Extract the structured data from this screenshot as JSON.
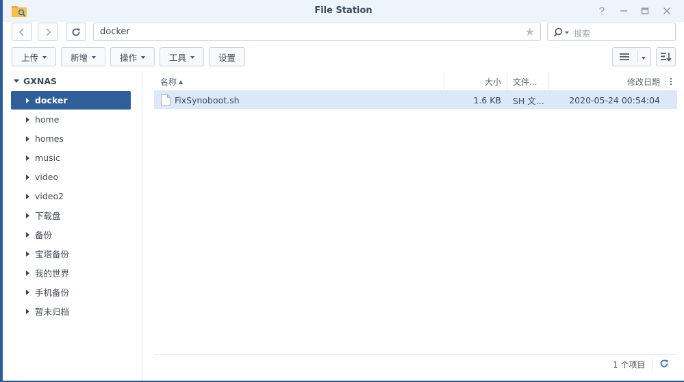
{
  "window": {
    "title": "File Station"
  },
  "nav": {
    "path": "docker",
    "search_placeholder": "搜索"
  },
  "toolbar": {
    "upload": "上传",
    "create": "新增",
    "action": "操作",
    "tools": "工具",
    "settings": "设置"
  },
  "tree": {
    "root": "GXNAS",
    "items": [
      {
        "label": "docker"
      },
      {
        "label": "home"
      },
      {
        "label": "homes"
      },
      {
        "label": "music"
      },
      {
        "label": "video"
      },
      {
        "label": "video2"
      },
      {
        "label": "下载盘"
      },
      {
        "label": "备份"
      },
      {
        "label": "宝塔备份"
      },
      {
        "label": "我的世界"
      },
      {
        "label": "手机备份"
      },
      {
        "label": "暂未归档"
      }
    ]
  },
  "list": {
    "columns": {
      "name": "名称",
      "size": "大小",
      "type": "文件...",
      "modified": "修改日期"
    },
    "sort_indicator": "▲",
    "rows": [
      {
        "name": "FixSynoboot.sh",
        "size": "1.6 KB",
        "type": "SH 文...",
        "modified": "2020-05-24 00:54:04"
      }
    ]
  },
  "footer": {
    "status": "1 个项目"
  },
  "colors": {
    "accent": "#2f5e98",
    "selected_row": "#dbe8f8",
    "titlebar": "#eef4fb"
  }
}
